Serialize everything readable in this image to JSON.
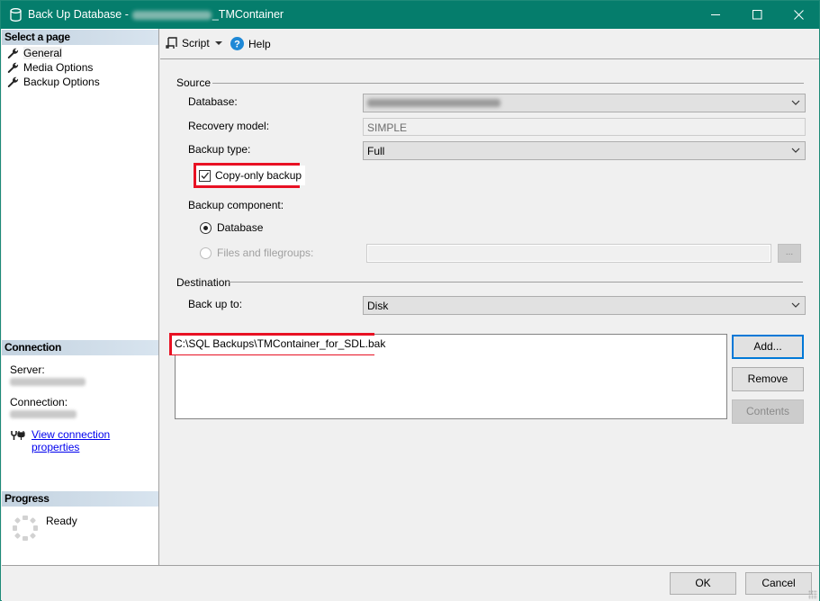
{
  "window": {
    "title_prefix": "Back Up Database -",
    "title_suffix": "_TMContainer",
    "controls": {
      "minimize": "minimize",
      "maximize": "maximize",
      "close": "close"
    }
  },
  "sidebar": {
    "select_page_header": "Select a page",
    "pages": [
      {
        "label": "General",
        "icon": "wrench-icon",
        "selected": true
      },
      {
        "label": "Media Options",
        "icon": "wrench-icon",
        "selected": false
      },
      {
        "label": "Backup Options",
        "icon": "wrench-icon",
        "selected": false
      }
    ],
    "connection": {
      "header": "Connection",
      "server_label": "Server:",
      "connection_label": "Connection:",
      "view_properties_link": "View connection properties"
    },
    "progress": {
      "header": "Progress",
      "status": "Ready"
    }
  },
  "toolbar": {
    "script_label": "Script",
    "help_label": "Help"
  },
  "source": {
    "group_title": "Source",
    "database_label": "Database:",
    "recovery_model_label": "Recovery model:",
    "recovery_model_value": "SIMPLE",
    "backup_type_label": "Backup type:",
    "backup_type_value": "Full",
    "copy_only_label": "Copy-only backup",
    "copy_only_checked": true,
    "backup_component_label": "Backup component:",
    "component_database_label": "Database",
    "component_files_label": "Files and filegroups:",
    "component_selected": "Database",
    "filegroups_button_label": "..."
  },
  "destination": {
    "group_title": "Destination",
    "back_up_to_label": "Back up to:",
    "back_up_to_value": "Disk",
    "paths": [
      "C:\\SQL Backups\\TMContainer_for_SDL.bak"
    ],
    "add_label": "Add...",
    "remove_label": "Remove",
    "contents_label": "Contents"
  },
  "footer": {
    "ok_label": "OK",
    "cancel_label": "Cancel"
  },
  "colors": {
    "titlebar": "#057d6c",
    "highlight_box": "#e81123",
    "focus_border": "#0078d7",
    "link": "#0000ee"
  }
}
